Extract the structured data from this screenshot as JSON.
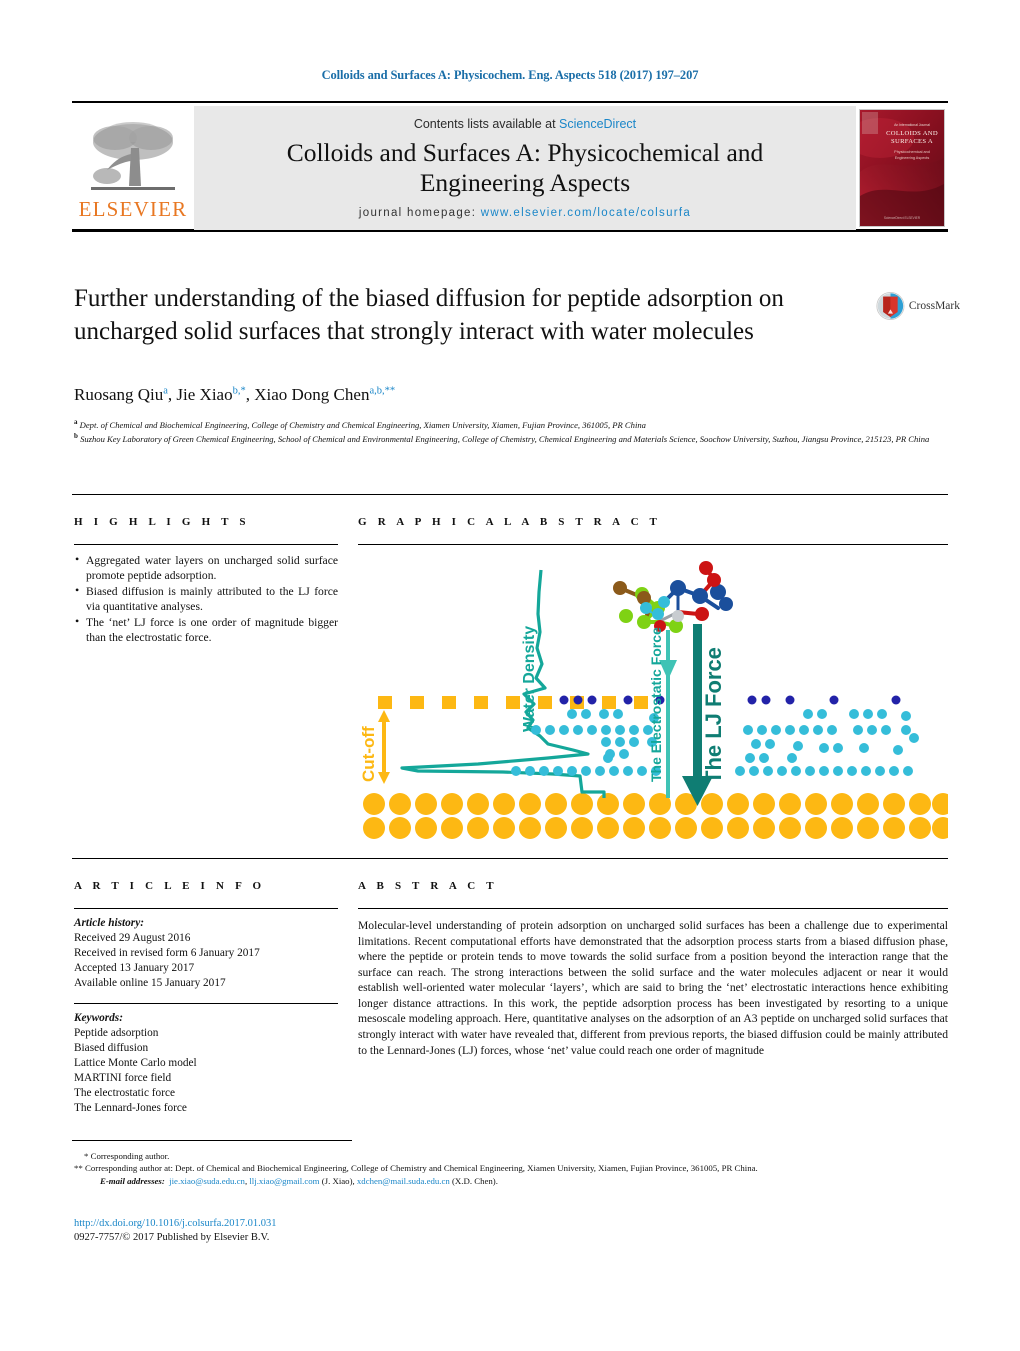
{
  "running_head": "Colloids and Surfaces A: Physicochem. Eng. Aspects 518 (2017) 197–207",
  "masthead": {
    "publisher_name": "ELSEVIER",
    "publisher_logo_icon": "elsevier-tree-icon",
    "contents_prefix": "Contents lists available at ",
    "contents_link": "ScienceDirect",
    "journal_title_line1": "Colloids and Surfaces A: Physicochemical and",
    "journal_title_line2": "Engineering Aspects",
    "homepage_prefix": "journal homepage: ",
    "homepage_url": "www.elsevier.com/locate/colsurfa",
    "cover_title_line1": "COLLOIDS AND",
    "cover_title_line2": "SURFACES A",
    "cover_subtitle_line1": "Physicochemical and",
    "cover_subtitle_line2": "Engineering Aspects",
    "cover_kicker": "An International Journal",
    "cover_color": "#8b1220"
  },
  "article": {
    "title": "Further understanding of the biased diffusion for peptide adsorption on uncharged solid surfaces that strongly interact with water molecules",
    "crossmark_label": "CrossMark",
    "authors_html": "Ruosang Qiu<sup>a</sup>, Jie Xiao<sup>b,*</sup>, Xiao Dong Chen<sup>a,b,**</sup>",
    "affiliation_a": "Dept. of Chemical and Biochemical Engineering, College of Chemistry and Chemical Engineering, Xiamen University, Xiamen, Fujian Province, 361005, PR China",
    "affiliation_b": "Suzhou Key Laboratory of Green Chemical Engineering, School of Chemical and Environmental Engineering, College of Chemistry, Chemical Engineering and Materials Science, Soochow University, Suzhou, Jiangsu Province, 215123, PR China"
  },
  "highlights": {
    "heading": "H I G H L I G H T S",
    "items": [
      "Aggregated water layers on uncharged solid surface promote peptide adsorption.",
      "Biased diffusion is mainly attributed to the LJ force via quantitative analyses.",
      "The ‘net’ LJ force is one order of magnitude bigger than the electrostatic force."
    ]
  },
  "graphical_abstract": {
    "heading": "G R A P H I C A L   A B S T R A C T",
    "labels": {
      "water_density": "Water Density",
      "cut_off": "Cut-off",
      "electrostatic_force": "The Electrostatic Force",
      "lj_force": "The LJ Force"
    },
    "colors": {
      "teal": "#14a79a",
      "dark_teal": "#0f7d73",
      "gold": "#fdb813",
      "light_blue": "#35bdd9",
      "dark_blue": "#2222a8"
    }
  },
  "article_info": {
    "heading": "A R T I C L E   I N F O",
    "history_label": "Article history:",
    "history": [
      "Received 29 August 2016",
      "Received in revised form 6 January 2017",
      "Accepted 13 January 2017",
      "Available online 15 January 2017"
    ],
    "keywords_label": "Keywords:",
    "keywords": [
      "Peptide adsorption",
      "Biased diffusion",
      "Lattice Monte Carlo model",
      "MARTINI force field",
      "The electrostatic force",
      "The Lennard-Jones force"
    ]
  },
  "abstract": {
    "heading": "A B S T R A C T",
    "body": "Molecular-level understanding of protein adsorption on uncharged solid surfaces has been a challenge due to experimental limitations. Recent computational efforts have demonstrated that the adsorption process starts from a biased diffusion phase, where the peptide or protein tends to move towards the solid surface from a position beyond the interaction range that the surface can reach. The strong interactions between the solid surface and the water molecules adjacent or near it would establish well-oriented water molecular ‘layers’, which are said to bring the ‘net’ electrostatic interactions hence exhibiting longer distance attractions. In this work, the peptide adsorption process has been investigated by resorting to a unique mesoscale modeling approach. Here, quantitative analyses on the adsorption of an A3 peptide on uncharged solid surfaces that strongly interact with water have revealed that, different from previous reports, the biased diffusion could be mainly attributed to the Lennard-Jones (LJ) forces, whose ‘net’ value could reach one order of magnitude"
  },
  "footnotes": {
    "corr1": "* Corresponding author.",
    "corr2": "** Corresponding author at: Dept. of Chemical and Biochemical Engineering, College of Chemistry and Chemical Engineering, Xiamen University, Xiamen, Fujian Province, 361005, PR China.",
    "email_label": "E-mail addresses:",
    "email1": "jie.xiao@suda.edu.cn",
    "email_sep1": ", ",
    "email2": "llj.xiao@gmail.com",
    "email_owner1": " (J. Xiao), ",
    "email3": "xdchen@mail.suda.edu.cn",
    "email_owner2": " (X.D. Chen).",
    "doi": "http://dx.doi.org/10.1016/j.colsurfa.2017.01.031",
    "copyright": "0927-7757/© 2017 Published by Elsevier B.V."
  }
}
